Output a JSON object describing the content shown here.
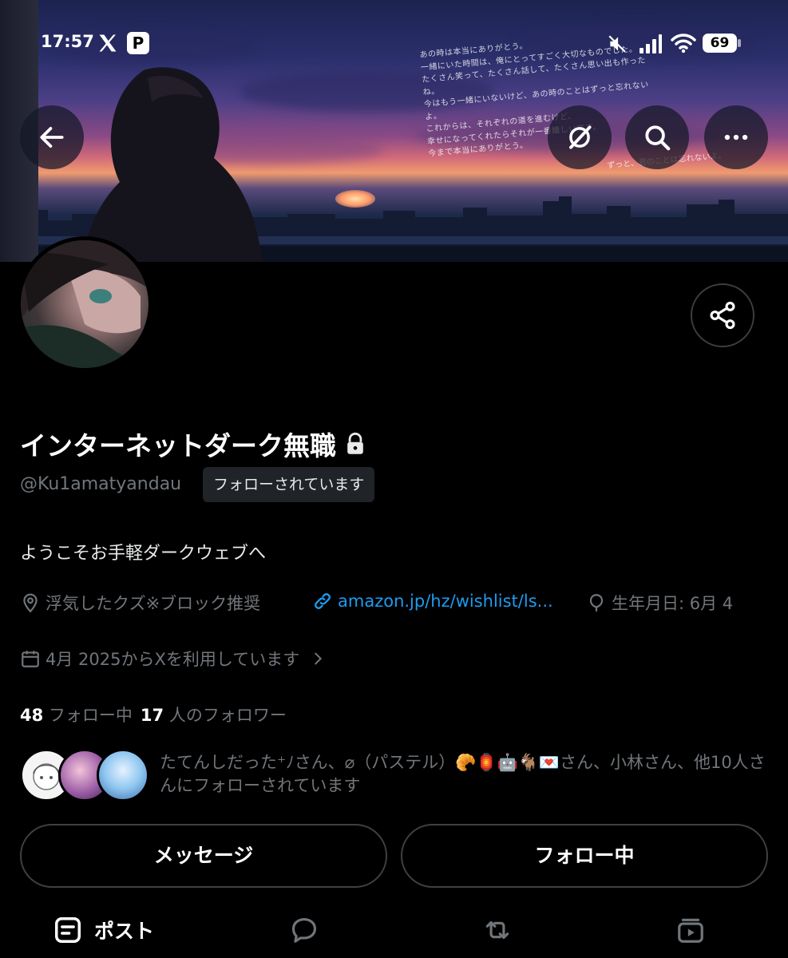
{
  "status_bar": {
    "time": "17:57",
    "battery": "69"
  },
  "banner": {
    "poem_lines": [
      "あの時は本当にありがとう。",
      "一緒にいた時間は、俺にとってすごく大切なものでした。",
      "たくさん笑って、たくさん話して、たくさん思い出も作ったね。",
      "今はもう一緒にいないけど、あの時のことはずっと忘れないよ。",
      "これからは、それぞれの道を進むけど、",
      "幸せになってくれたらそれが一番嬉しいです。",
      "今まで本当にありがとう。"
    ],
    "poem_tail": "ずっと、君のことは忘れないよ。"
  },
  "profile": {
    "name": "インターネットダーク無職",
    "handle": "@Ku1amatyandau",
    "follows_you": "フォローされています",
    "bio": "ようこそお手軽ダークウェブへ",
    "location": "浮気したクズ※ブロック推奨",
    "link": "amazon.jp/hz/wishlist/ls...",
    "birthday": "生年月日: 6月 4",
    "joined": "4月 2025からXを利用しています"
  },
  "stats": {
    "following_count": "48",
    "following_label": "フォロー中",
    "followers_count": "17",
    "followers_label": "人のフォロワー"
  },
  "mutuals": {
    "text": "たてんしだった⁺ﾉさん、⌀（パステル）🥐🏮🤖🐐💌さん、小林さん、他10人さんにフォローされています"
  },
  "actions": {
    "message": "メッセージ",
    "following": "フォロー中"
  },
  "tabs": {
    "posts": "ポスト"
  },
  "colors": {
    "background": "#000000",
    "link": "#1d9bf0",
    "secondary_text": "#71767b",
    "primary_text": "#e7e9ea"
  },
  "icons": [
    "back-arrow-icon",
    "grok-icon",
    "search-icon",
    "more-icon",
    "share-icon",
    "lock-icon",
    "location-icon",
    "link-icon",
    "balloon-icon",
    "calendar-icon",
    "chevron-right-icon",
    "posts-icon",
    "replies-icon",
    "repost-icon",
    "media-icon"
  ]
}
